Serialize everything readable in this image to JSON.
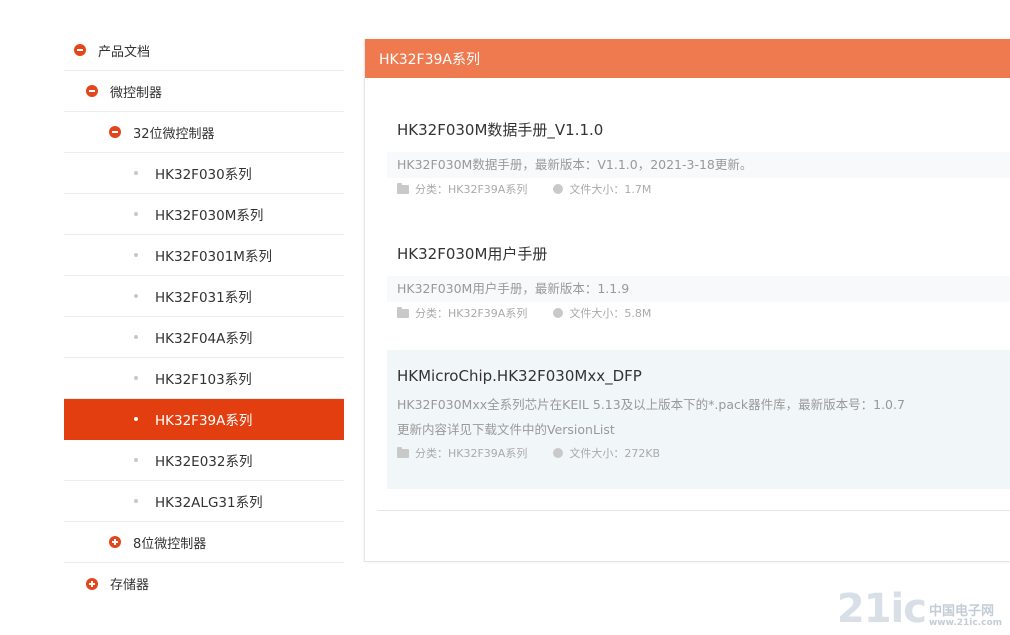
{
  "sidebar": {
    "items": [
      {
        "label": "产品文档",
        "level": 0,
        "toggle": "minus"
      },
      {
        "label": "微控制器",
        "level": 1,
        "toggle": "minus"
      },
      {
        "label": "32位微控制器",
        "level": 2,
        "toggle": "minus"
      },
      {
        "label": "HK32F030系列",
        "level": 3
      },
      {
        "label": "HK32F030M系列",
        "level": 3
      },
      {
        "label": "HK32F0301M系列",
        "level": 3
      },
      {
        "label": "HK32F031系列",
        "level": 3
      },
      {
        "label": "HK32F04A系列",
        "level": 3
      },
      {
        "label": "HK32F103系列",
        "level": 3
      },
      {
        "label": "HK32F39A系列",
        "level": 3,
        "active": true
      },
      {
        "label": "HK32E032系列",
        "level": 3
      },
      {
        "label": "HK32ALG31系列",
        "level": 3
      },
      {
        "label": "8位微控制器",
        "level": 2,
        "toggle": "plus"
      },
      {
        "label": "存储器",
        "level": 1,
        "toggle": "plus"
      }
    ]
  },
  "panel": {
    "header": "HK32F39A系列",
    "items": [
      {
        "title": "HK32F030M数据手册_V1.1.0",
        "desc": [
          "HK32F030M数据手册，最新版本：V1.1.0，2021-3-18更新。"
        ],
        "category": "分类：HK32F39A系列",
        "size": "文件大小：1.7M"
      },
      {
        "title": "HK32F030M用户手册",
        "desc": [
          "HK32F030M用户手册，最新版本：1.1.9"
        ],
        "category": "分类：HK32F39A系列",
        "size": "文件大小：5.8M"
      },
      {
        "title": "HKMicroChip.HK32F030Mxx_DFP",
        "desc": [
          "HK32F030Mxx全系列芯片在KEIL 5.13及以上版本下的*.pack器件库，最新版本号：1.0.7",
          "更新内容详见下载文件中的VersionList"
        ],
        "category": "分类：HK32F39A系列",
        "size": "文件大小：272KB"
      }
    ]
  },
  "watermark": {
    "logo": "21ic",
    "line1": "中国电子网",
    "line2": "www.21ic.com"
  },
  "colors": {
    "accent": "#e23e0f",
    "header": "#f07a4f"
  }
}
